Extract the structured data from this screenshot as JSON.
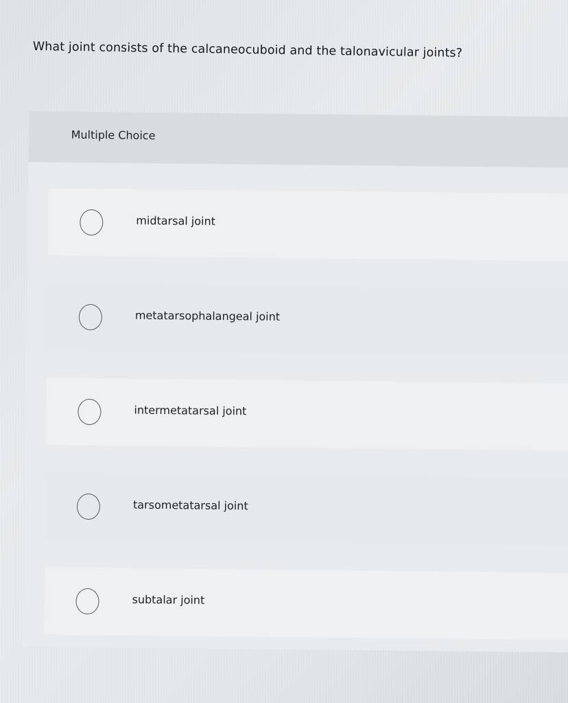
{
  "question": {
    "text": "What joint consists of the calcaneocuboid and the talonavicular joints?"
  },
  "section": {
    "label": "Multiple Choice"
  },
  "options": [
    {
      "label": "midtarsal joint"
    },
    {
      "label": "metatarsophalangeal joint"
    },
    {
      "label": "intermetatarsal joint"
    },
    {
      "label": "tarsometatarsal joint"
    },
    {
      "label": "subtalar joint"
    }
  ],
  "colors": {
    "background": "#e4e8ea",
    "panel": "#e8ebed",
    "header": "#d8dcdf",
    "text": "#1a1d21",
    "radio_border": "#55595e"
  }
}
